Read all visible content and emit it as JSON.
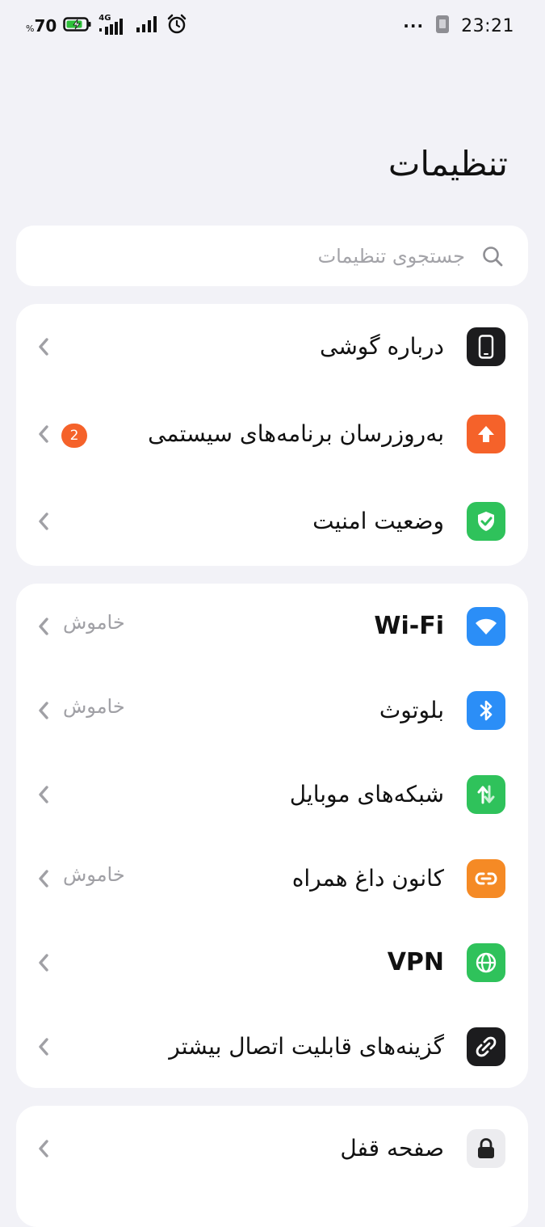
{
  "status_bar": {
    "battery_percent": "70",
    "percent_sign": "%",
    "network_type": "4G",
    "time": "23:21",
    "dots": "···"
  },
  "header": {
    "title": "تنظیمات"
  },
  "search": {
    "placeholder": "جستجوی تنظیمات"
  },
  "groups": [
    {
      "items": [
        {
          "label": "درباره گوشی",
          "icon": "phone-icon",
          "color": "#1c1c1e"
        },
        {
          "label": "به‌روزرسان برنامه‌های سیستمی",
          "icon": "arrow-up-icon",
          "color": "#f5622a",
          "badge": "2"
        },
        {
          "label": "وضعیت امنیت",
          "icon": "shield-check-icon",
          "color": "#2fc25b"
        }
      ]
    },
    {
      "items": [
        {
          "label": "Wi-Fi",
          "icon": "wifi-icon",
          "color": "#2b8ef7",
          "value": "خاموش"
        },
        {
          "label": "بلوتوث",
          "icon": "bluetooth-icon",
          "color": "#2b8ef7",
          "value": "خاموش"
        },
        {
          "label": "شبکه‌های موبایل",
          "icon": "mobile-data-icon",
          "color": "#2fc25b"
        },
        {
          "label": "کانون داغ همراه",
          "icon": "hotspot-icon",
          "color": "#f58a25",
          "value": "خاموش"
        },
        {
          "label": "VPN",
          "icon": "globe-icon",
          "color": "#2fc25b"
        },
        {
          "label": "گزینه‌های قابلیت اتصال بیشتر",
          "icon": "link-icon",
          "color": "#1c1c1e"
        }
      ]
    },
    {
      "items": [
        {
          "label": "صفحه قفل",
          "icon": "lock-icon",
          "color": "#ececef"
        }
      ]
    }
  ]
}
